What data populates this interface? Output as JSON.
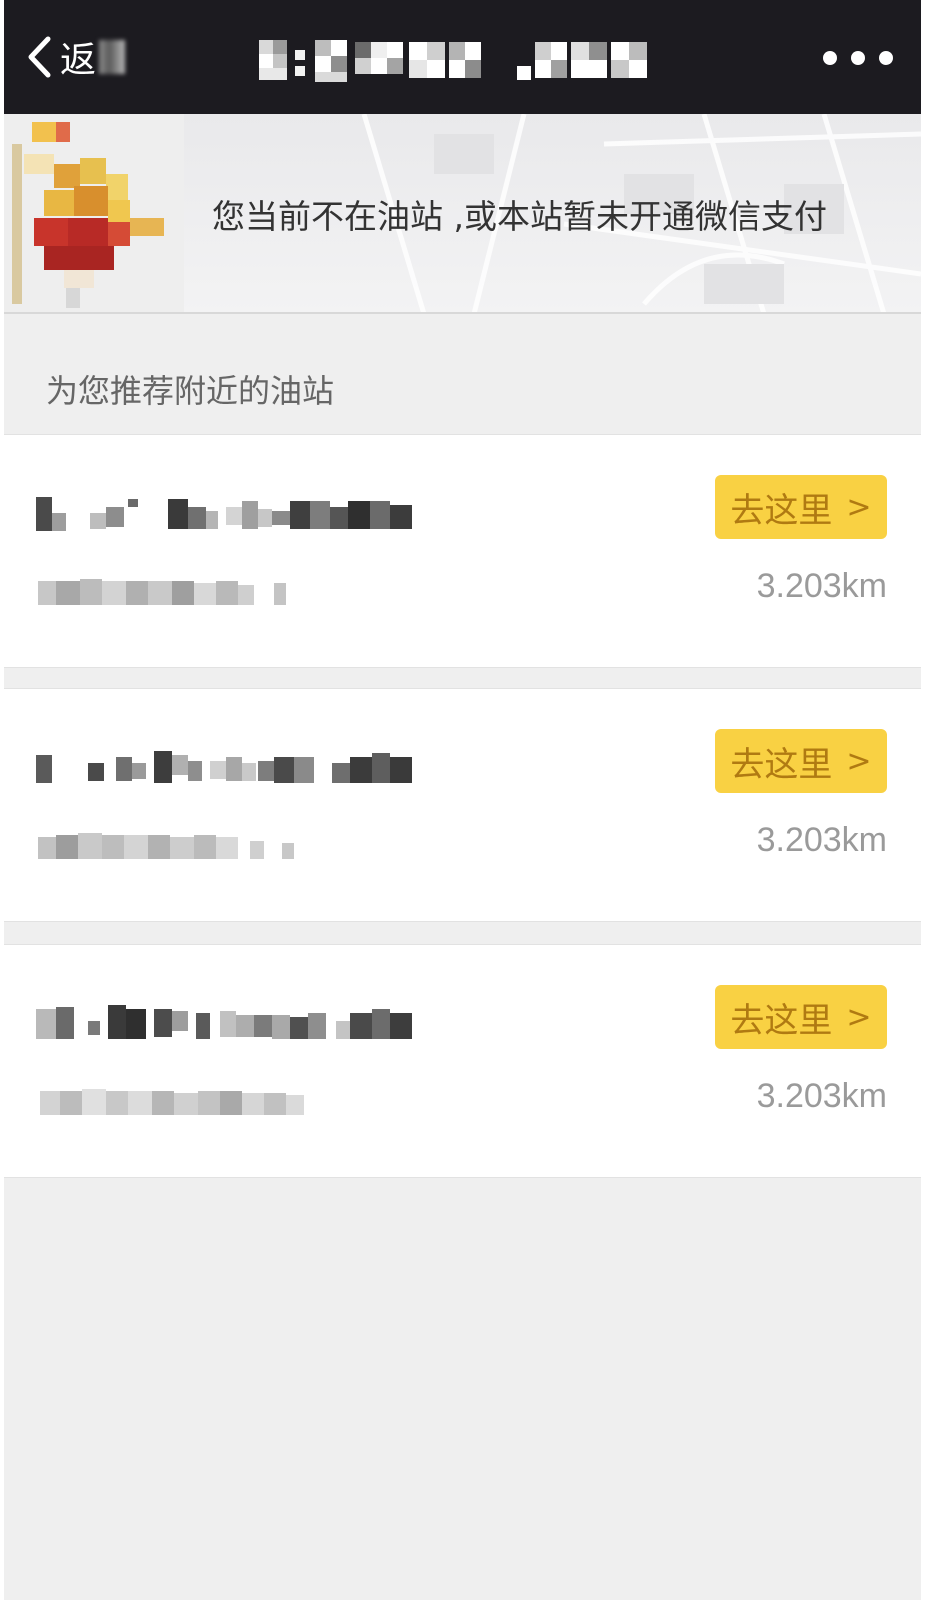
{
  "nav": {
    "back_label": "返",
    "more_icon": "more-dots-icon",
    "back_icon": "chevron-left-icon"
  },
  "banner": {
    "message": "您当前不在油站 ,或本站暂未开通微信支付",
    "mascot_icon": "pixelated-mascot-image"
  },
  "section": {
    "title": "为您推荐附近的油站"
  },
  "stations": [
    {
      "go_label": "去这里",
      "arrow": ">",
      "distance": "3.203km"
    },
    {
      "go_label": "去这里",
      "arrow": ">",
      "distance": "3.203km"
    },
    {
      "go_label": "去这里",
      "arrow": ">",
      "distance": "3.203km"
    }
  ],
  "colors": {
    "navbar": "#1c1b20",
    "button_bg": "#f9d143",
    "button_text": "#b07a12",
    "page_bg": "#efefef"
  }
}
